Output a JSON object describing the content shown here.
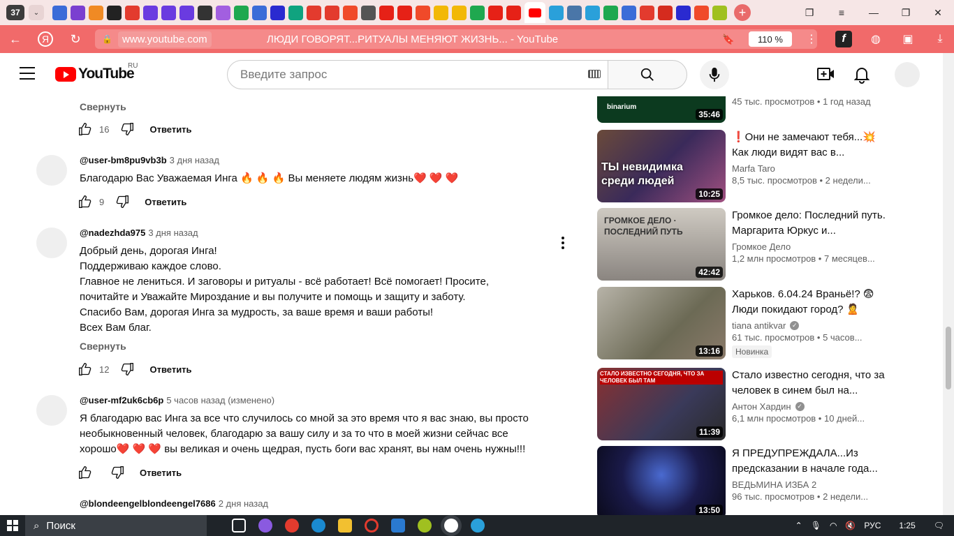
{
  "browser": {
    "tab_count": "37",
    "url_host": "www.youtube.com",
    "page_title": "ЛЮДИ ГОВОРЯТ...РИТУАЛЫ МЕНЯЮТ ЖИЗНЬ... - YouTube",
    "zoom": "110 %",
    "fav_colors": [
      "#3b6cd8",
      "#7b3fd0",
      "#f08a24",
      "#222222",
      "#e33b2e",
      "#6a3be0",
      "#6a3be0",
      "#6a3be0",
      "#333333",
      "#a25fe0",
      "#1fa84f",
      "#3b6cd8",
      "#2a2ad0",
      "#10a37f",
      "#e33b2e",
      "#e33b2e",
      "#f04a2a",
      "#555555",
      "#e62117",
      "#e62117",
      "#f04a2a",
      "#f2b807",
      "#f2b807",
      "#1fa84f",
      "#e62117",
      "#e62117",
      "#2aa0da",
      "#4a76a8",
      "#2aa0da",
      "#1fa84f",
      "#3b6cd8",
      "#e33b2e",
      "#d52b1e",
      "#2a2ad0",
      "#f04a2a",
      "#a0c020"
    ]
  },
  "youtube": {
    "logo_text": "YouTube",
    "region": "RU",
    "search_placeholder": "Введите запрос"
  },
  "comments": [
    {
      "collapse": "Свернуть",
      "likes": "16",
      "reply": "Ответить"
    },
    {
      "user": "@user-bm8pu9vb3b",
      "time": "3 дня назад",
      "text": "Благодарю Вас Уважаемая Инга 🔥 🔥 🔥  Вы меняете людям жизнь❤️ ❤️ ❤️",
      "likes": "9",
      "reply": "Ответить"
    },
    {
      "user": "@nadezhda975",
      "time": "3 дня назад",
      "text": "Добрый день, дорогая Инга!\nПоддерживаю каждое слово.\nГлавное не лениться. И заговоры и ритуалы - всё работает! Всё помогает! Просите,\nпочитайте и Уважайте Мироздание и вы получите и помощь и защиту и заботу.\nСпасибо Вам, дорогая Инга за мудрость, за ваше время и ваши работы!\nВсех Вам благ.",
      "collapse": "Свернуть",
      "likes": "12",
      "reply": "Ответить"
    },
    {
      "user": "@user-mf2uk6cb6p",
      "time": "5 часов назад (изменено)",
      "text": "Я благодарю вас Инга за все что случилось со мной за это время что я вас знаю, вы просто\nнеобыкновенный человек, благодарю за вашу силу и за то что в моей жизни сейчас все\nхорошо❤️ ❤️ ❤️  вы великая и очень щедрая, пусть боги вас хранят, вы нам очень нужны!!!",
      "likes": "",
      "reply": "Ответить"
    },
    {
      "user": "@blondeengelblondeengel7686",
      "time": "2 дня назад"
    }
  ],
  "videos": [
    {
      "title": "",
      "channel": "",
      "meta": "45 тыс. просмотров • 1 год назад",
      "duration": "35:46",
      "thumb_text": "binarium",
      "thumb_color": "#0c3a1f"
    },
    {
      "title": "❗Они не замечают тебя...💥 Как люди видят вас в...",
      "channel": "Marfa Taro",
      "meta": "8,5 тыс. просмотров • 2 недели...",
      "duration": "10:25",
      "thumb_text": "ТЫ невидимка среди людей",
      "thumb_color": "#4a3a5a"
    },
    {
      "title": "Громкое дело: Последний путь. Маргарита Юркус и...",
      "channel": "Громкое Дело",
      "meta": "1,2 млн просмотров • 7 месяцев...",
      "duration": "42:42",
      "thumb_text": "ГРОМКОЕ ДЕЛО · ПОСЛЕДНИЙ ПУТЬ",
      "thumb_color": "#5a5550"
    },
    {
      "title": "Харьков. 6.04.24 Враньё!? 😨 Люди покидают город? 🙎",
      "channel": "tiana antikvar",
      "verified": true,
      "meta": "61 тыс. просмотров • 5 часов...",
      "badge": "Новинка",
      "duration": "13:16",
      "thumb_text": "",
      "thumb_color": "#8a8070"
    },
    {
      "title": "Стало известно сегодня, что за человек в синем был на...",
      "channel": "Антон Хардин",
      "verified": true,
      "meta": "6,1 млн просмотров • 10 дней...",
      "duration": "11:39",
      "thumb_text": "СТАЛО ИЗВЕСТНО СЕГОДНЯ, ЧТО ЗА ЧЕЛОВЕК БЫЛ ТАМ",
      "thumb_color": "#6a2020"
    },
    {
      "title": "Я ПРЕДУПРЕЖДАЛА...Из предсказании в начале года...",
      "channel": "ВЕДЬМИНА ИЗБА 2",
      "meta": "96 тыс. просмотров • 2 недели...",
      "duration": "13:50",
      "thumb_text": "",
      "thumb_color": "#12163a"
    }
  ],
  "taskbar": {
    "search_label": "Поиск",
    "lang": "РУС",
    "time": "1:25"
  }
}
